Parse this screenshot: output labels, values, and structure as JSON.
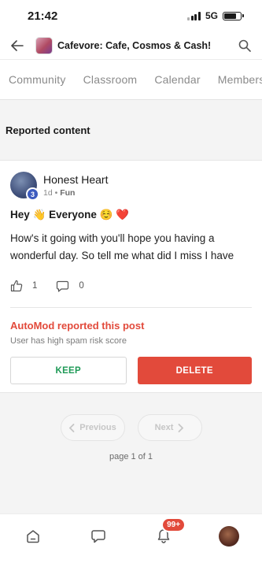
{
  "status": {
    "time": "21:42",
    "network": "5G",
    "battery_level": 0.75
  },
  "header": {
    "group_name": "Cafevore: Cafe, Cosmos & Cash!"
  },
  "tabs": [
    "Community",
    "Classroom",
    "Calendar",
    "Members"
  ],
  "section": {
    "title": "Reported content"
  },
  "post": {
    "author": "Honest Heart",
    "level": "3",
    "time_ago": "1d",
    "separator": "•",
    "category": "Fun",
    "title": "Hey 👋 Everyone ☺️ ❤️",
    "body": "How's it going with you'll hope you having a wonderful day. So tell me what did I miss I have",
    "likes": "1",
    "comments": "0"
  },
  "automod": {
    "title": "AutoMod reported this post",
    "reason": "User has high spam risk score"
  },
  "actions": {
    "keep_label": "KEEP",
    "delete_label": "DELETE"
  },
  "pagination": {
    "prev_label": "Previous",
    "next_label": "Next",
    "info": "page 1 of 1"
  },
  "bottom_nav": {
    "notif_count": "99+"
  },
  "colors": {
    "accent_red": "#e24a3b",
    "keep_green": "#1f9a57",
    "level_blue": "#3d5bbf"
  }
}
